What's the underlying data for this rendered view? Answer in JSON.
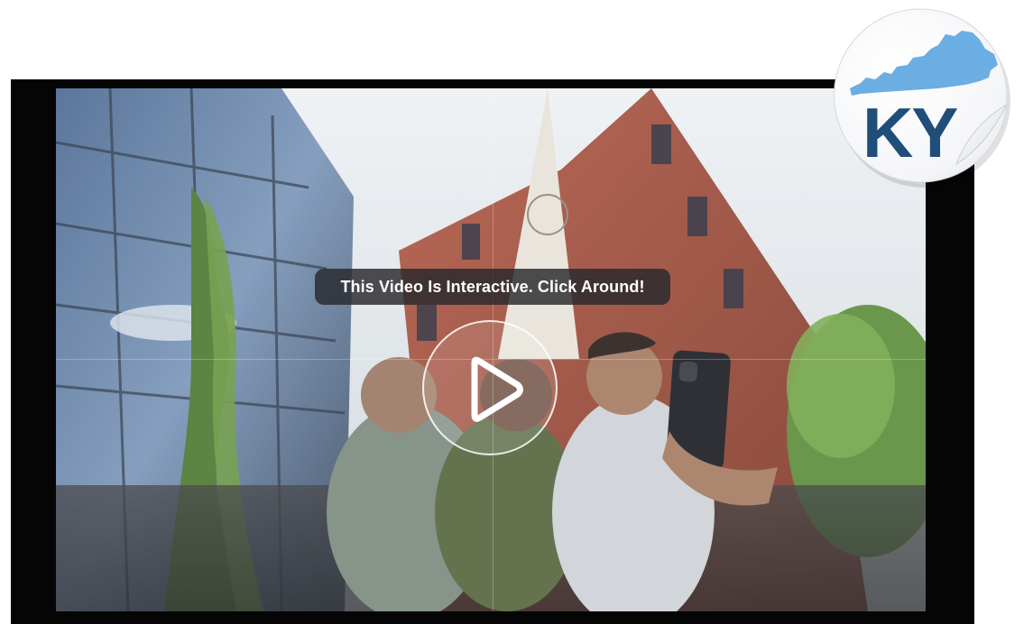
{
  "video": {
    "overlay_caption": "This Video Is Interactive. Click Around!",
    "play_icon": "play-icon"
  },
  "badge": {
    "text": "KY",
    "icon": "kentucky-state-outline",
    "colors": {
      "state_fill": "#6aaee3",
      "text": "#1f4e79",
      "sticker": "#ffffff"
    }
  }
}
